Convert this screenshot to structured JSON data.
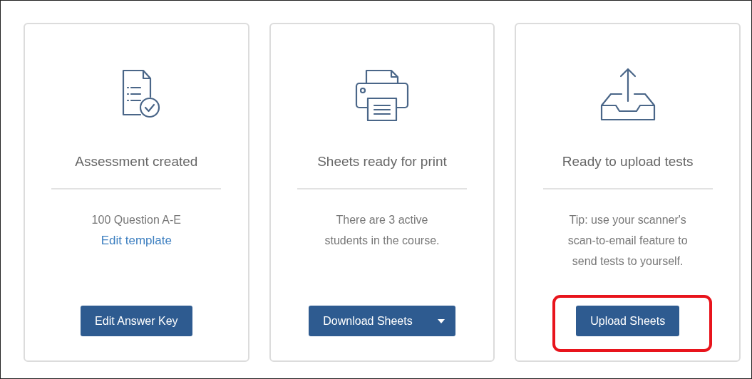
{
  "cards": [
    {
      "kind": "document-check",
      "title": "Assessment created",
      "description": "100 Question A-E",
      "link": "Edit template",
      "button": {
        "label": "Edit Answer Key",
        "dropdown": false,
        "highlighted": false
      }
    },
    {
      "kind": "printer",
      "title": "Sheets ready for print",
      "description": "There are 3 active students in the course.",
      "button": {
        "label": "Download Sheets",
        "dropdown": true,
        "highlighted": false
      }
    },
    {
      "kind": "tray-upload",
      "title": "Ready to upload tests",
      "description": "Tip: use your scanner's scan-to-email feature to send tests to yourself.",
      "button": {
        "label": "Upload Sheets",
        "dropdown": false,
        "highlighted": true
      }
    }
  ]
}
